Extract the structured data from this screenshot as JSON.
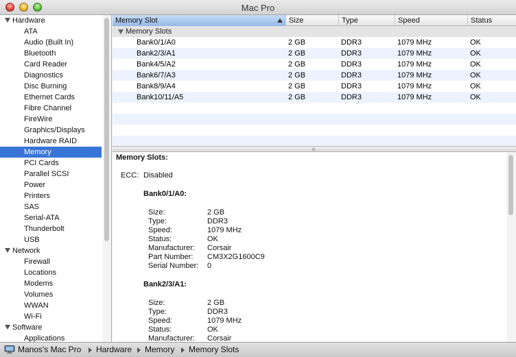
{
  "window": {
    "title": "Mac Pro"
  },
  "sidebar": {
    "items": [
      {
        "label": "Hardware",
        "type": "category"
      },
      {
        "label": "ATA",
        "type": "child"
      },
      {
        "label": "Audio (Built In)",
        "type": "child"
      },
      {
        "label": "Bluetooth",
        "type": "child"
      },
      {
        "label": "Card Reader",
        "type": "child"
      },
      {
        "label": "Diagnostics",
        "type": "child"
      },
      {
        "label": "Disc Burning",
        "type": "child"
      },
      {
        "label": "Ethernet Cards",
        "type": "child"
      },
      {
        "label": "Fibre Channel",
        "type": "child"
      },
      {
        "label": "FireWire",
        "type": "child"
      },
      {
        "label": "Graphics/Displays",
        "type": "child"
      },
      {
        "label": "Hardware RAID",
        "type": "child"
      },
      {
        "label": "Memory",
        "type": "child",
        "selected": true
      },
      {
        "label": "PCI Cards",
        "type": "child"
      },
      {
        "label": "Parallel SCSI",
        "type": "child"
      },
      {
        "label": "Power",
        "type": "child"
      },
      {
        "label": "Printers",
        "type": "child"
      },
      {
        "label": "SAS",
        "type": "child"
      },
      {
        "label": "Serial-ATA",
        "type": "child"
      },
      {
        "label": "Thunderbolt",
        "type": "child"
      },
      {
        "label": "USB",
        "type": "child"
      },
      {
        "label": "Network",
        "type": "category"
      },
      {
        "label": "Firewall",
        "type": "child"
      },
      {
        "label": "Locations",
        "type": "child"
      },
      {
        "label": "Modems",
        "type": "child"
      },
      {
        "label": "Volumes",
        "type": "child"
      },
      {
        "label": "WWAN",
        "type": "child"
      },
      {
        "label": "Wi-Fi",
        "type": "child"
      },
      {
        "label": "Software",
        "type": "category"
      },
      {
        "label": "Applications",
        "type": "child"
      }
    ]
  },
  "table": {
    "columns": [
      "Memory Slot",
      "Size",
      "Type",
      "Speed",
      "Status"
    ],
    "group_label": "Memory Slots",
    "rows": [
      [
        "Bank0/1/A0",
        "2 GB",
        "DDR3",
        "1079 MHz",
        "OK"
      ],
      [
        "Bank2/3/A1",
        "2 GB",
        "DDR3",
        "1079 MHz",
        "OK"
      ],
      [
        "Bank4/5/A2",
        "2 GB",
        "DDR3",
        "1079 MHz",
        "OK"
      ],
      [
        "Bank6/7/A3",
        "2 GB",
        "DDR3",
        "1079 MHz",
        "OK"
      ],
      [
        "Bank8/9/A4",
        "2 GB",
        "DDR3",
        "1079 MHz",
        "OK"
      ],
      [
        "Bank10/11/A5",
        "2 GB",
        "DDR3",
        "1079 MHz",
        "OK"
      ]
    ]
  },
  "detail": {
    "heading": "Memory Slots:",
    "ecc_label": "ECC:",
    "ecc_value": "Disabled",
    "banks": [
      {
        "title": "Bank0/1/A0:",
        "fields": [
          [
            "Size:",
            "2 GB"
          ],
          [
            "Type:",
            "DDR3"
          ],
          [
            "Speed:",
            "1079 MHz"
          ],
          [
            "Status:",
            "OK"
          ],
          [
            "Manufacturer:",
            "Corsair"
          ],
          [
            "Part Number:",
            "CM3X2G1600C9"
          ],
          [
            "Serial Number:",
            "0"
          ]
        ]
      },
      {
        "title": "Bank2/3/A1:",
        "fields": [
          [
            "Size:",
            "2 GB"
          ],
          [
            "Type:",
            "DDR3"
          ],
          [
            "Speed:",
            "1079 MHz"
          ],
          [
            "Status:",
            "OK"
          ],
          [
            "Manufacturer:",
            "Corsair"
          ]
        ]
      }
    ]
  },
  "statusbar": {
    "breadcrumb": [
      "Manos's Mac Pro",
      "Hardware",
      "Memory",
      "Memory Slots"
    ]
  },
  "colors": {
    "selection": "#3875d7",
    "row_alt": "#edf3fe"
  }
}
